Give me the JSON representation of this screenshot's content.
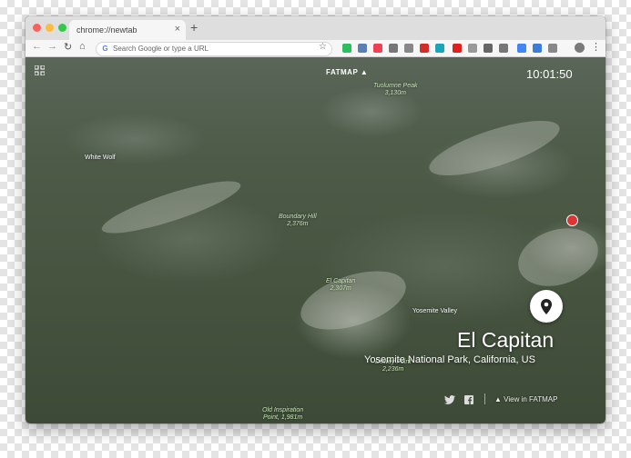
{
  "browser": {
    "tab": {
      "title": "chrome://newtab",
      "close_symbol": "×"
    },
    "new_tab_symbol": "+",
    "nav": {
      "back": "←",
      "forward": "→",
      "reload": "↻",
      "home": "⌂"
    },
    "omnibox": {
      "placeholder": "Search Google or type a URL",
      "value": "",
      "google_glyph": "G"
    },
    "bookmark_symbol": "☆",
    "menu_symbol": "⋮",
    "extensions": [
      {
        "name": "evernote-icon",
        "color": "#2dbe60"
      },
      {
        "name": "screenshot-icon",
        "color": "#5a7fb5"
      },
      {
        "name": "pocket-icon",
        "color": "#ef4056"
      },
      {
        "name": "camera-icon",
        "color": "#777777"
      },
      {
        "name": "scan-icon",
        "color": "#888888"
      },
      {
        "name": "lastpass-icon",
        "color": "#d32d27"
      },
      {
        "name": "colorpick-icon",
        "color": "#1aa6b7"
      },
      {
        "name": "adblock-icon",
        "color": "#e21f1f"
      },
      {
        "name": "ghost-icon",
        "color": "#999999"
      },
      {
        "name": "ninja-icon",
        "color": "#666666"
      },
      {
        "name": "shield-icon",
        "color": "#777777"
      },
      {
        "name": "translate-icon",
        "color": "#4285f4"
      },
      {
        "name": "checklist-icon",
        "color": "#3b7dd8"
      },
      {
        "name": "font-icon",
        "color": "#888888"
      }
    ]
  },
  "newtab": {
    "logo": "FATMAP",
    "clock": "10:01:50",
    "place": {
      "name": "El Capitan",
      "location": "Yosemite National Park, California, US"
    },
    "view_link": "View in FATMAP",
    "map_labels": {
      "tuolumne": [
        "Tuolumne Peak",
        "3,130m"
      ],
      "boundary": [
        "Boundary Hill",
        "2,376m"
      ],
      "el_capitan": [
        "El Capitan",
        "2,307m"
      ],
      "dewey": [
        "Dewey Point",
        "2,236m"
      ],
      "old_inspiration": [
        "Old Inspiration",
        "Point, 1,981m"
      ]
    },
    "place_labels": {
      "white_wolf": "White Wolf",
      "yosemite_valley": "Yosemite Valley"
    }
  },
  "colors": {
    "accent_red": "#e23333",
    "text_on_map": "#ffffff"
  }
}
